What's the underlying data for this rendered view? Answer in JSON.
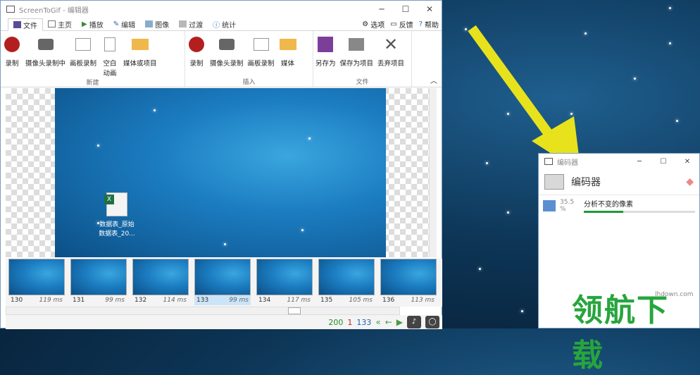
{
  "main_window": {
    "app_title": "ScreenToGif - 编辑器",
    "controls": {
      "min": "─",
      "max": "☐",
      "close": "✕"
    },
    "tabs": [
      {
        "label": "文件",
        "icon": "save-icon"
      },
      {
        "label": "主页",
        "icon": "home-icon"
      },
      {
        "label": "播放",
        "icon": "play-icon"
      },
      {
        "label": "编辑",
        "icon": "pencil-icon"
      },
      {
        "label": "图像",
        "icon": "image-icon"
      },
      {
        "label": "过渡",
        "icon": "transition-icon"
      },
      {
        "label": "统计",
        "icon": "info-icon"
      }
    ],
    "right_tools": {
      "options": "选项",
      "feedback": "反馈",
      "help": "帮助"
    },
    "ribbon_groups": [
      {
        "label": "新建",
        "buttons": [
          "录制",
          "摄像头录制中",
          "画板录制",
          "空白动画",
          "媒体或项目"
        ]
      },
      {
        "label": "插入",
        "buttons": [
          "录制",
          "摄像头录制",
          "画板录制",
          "媒体"
        ]
      },
      {
        "label": "文件",
        "buttons": [
          "另存为",
          "保存为项目",
          "丢弃项目"
        ]
      }
    ],
    "desktop_file": {
      "line1": "数据表_原始",
      "line2": "数据表_20..."
    },
    "frames": [
      {
        "num": "130",
        "ms": "119 ms"
      },
      {
        "num": "131",
        "ms": "99 ms"
      },
      {
        "num": "132",
        "ms": "114 ms"
      },
      {
        "num": "133",
        "ms": "99 ms"
      },
      {
        "num": "134",
        "ms": "117 ms"
      },
      {
        "num": "135",
        "ms": "105 ms"
      },
      {
        "num": "136",
        "ms": "113 ms"
      }
    ],
    "status": {
      "total": "200",
      "selected": "1",
      "current": "133"
    }
  },
  "encoder_window": {
    "title": "编码器",
    "header": "编码器",
    "item": {
      "percent": "35.5 %",
      "task": "分析不变的像素",
      "progress": 35.5
    }
  },
  "watermark": {
    "text": "领航下载",
    "url": "lhdown.com"
  }
}
